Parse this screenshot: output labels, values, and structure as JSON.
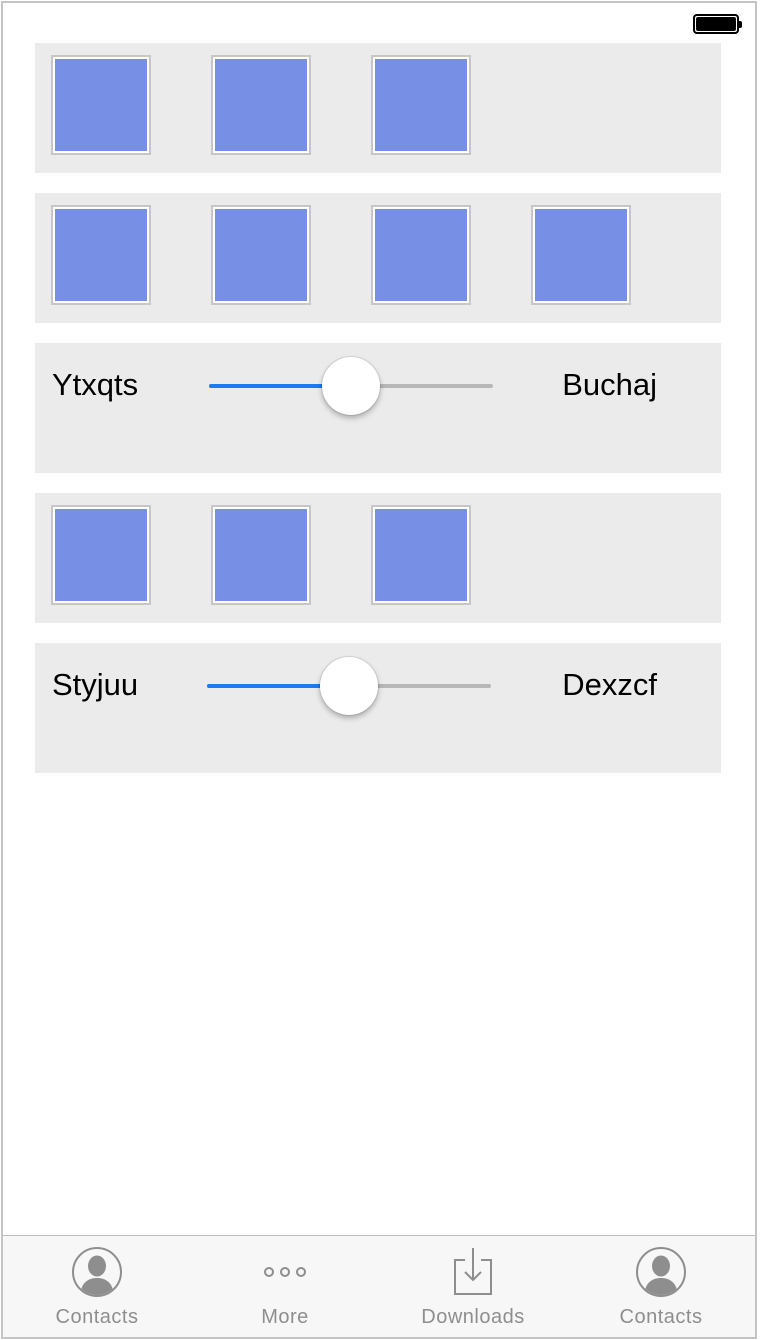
{
  "rows": [
    {
      "type": "tiles",
      "count": 3
    },
    {
      "type": "tiles",
      "count": 4
    },
    {
      "type": "slider",
      "label_left": "Ytxqts",
      "label_right": "Buchaj",
      "value": 0.5
    },
    {
      "type": "tiles",
      "count": 3
    },
    {
      "type": "slider",
      "label_left": "Styjuu",
      "label_right": "Dexzcf",
      "value": 0.5
    }
  ],
  "tab_bar": {
    "items": [
      {
        "label": "Contacts",
        "icon": "contacts-icon"
      },
      {
        "label": "More",
        "icon": "more-icon"
      },
      {
        "label": "Downloads",
        "icon": "downloads-icon"
      },
      {
        "label": "Contacts",
        "icon": "contacts-icon"
      }
    ]
  },
  "colors": {
    "tile": "#778fe5",
    "slider_fill": "#1a7cf0",
    "row_background": "#ebebeb",
    "tab_label": "#8e8e8e"
  }
}
